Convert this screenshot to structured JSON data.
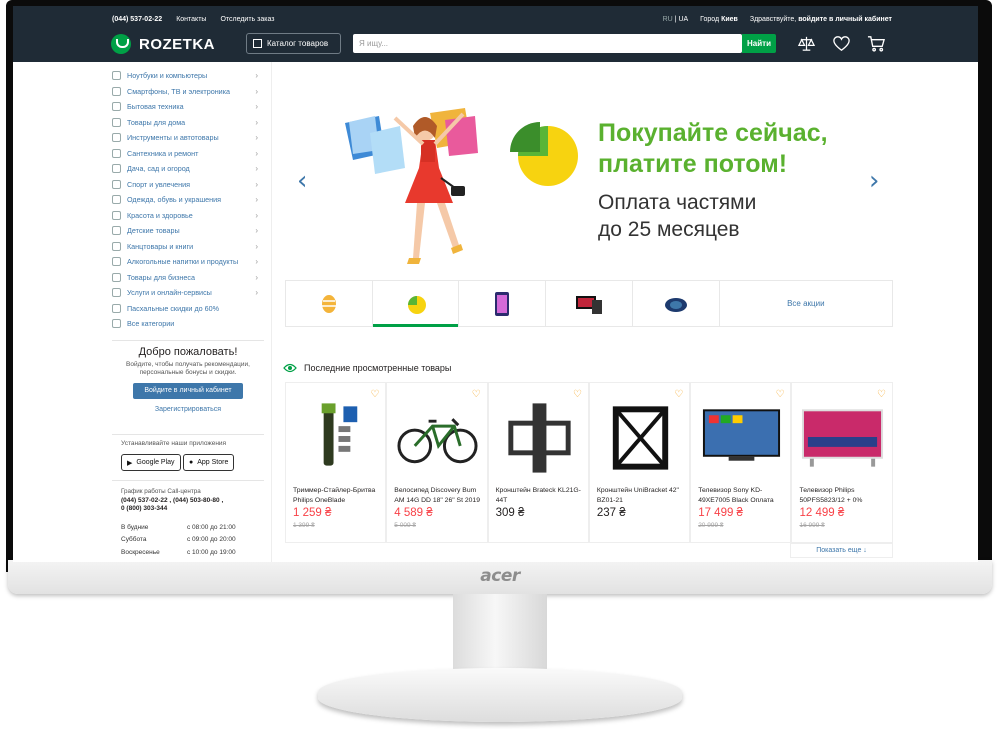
{
  "header": {
    "phone": "(044) 537-02-22",
    "contacts": "Контакты",
    "track": "Отследить заказ",
    "lang_ru": "RU",
    "lang_ua": "UA",
    "city_label": "Город",
    "city": "Киев",
    "greeting": "Здравствуйте,",
    "login_link": "войдите в личный кабинет",
    "logo": "ROZETKA",
    "catalog_button": "Каталог товаров",
    "search_placeholder": "Я ищу...",
    "search_button": "Найти",
    "icons": [
      "compare-icon",
      "heart-icon",
      "cart-icon"
    ]
  },
  "sidebar": {
    "categories": [
      "Ноутбуки и компьютеры",
      "Смартфоны, ТВ и электроника",
      "Бытовая техника",
      "Товары для дома",
      "Инструменты и автотовары",
      "Сантехника и ремонт",
      "Дача, сад и огород",
      "Спорт и увлечения",
      "Одежда, обувь и украшения",
      "Красота и здоровье",
      "Детские товары",
      "Канцтовары и книги",
      "Алкогольные напитки и продукты",
      "Товары для бизнеса",
      "Услуги и онлайн-сервисы",
      "Пасхальные скидки до 60%",
      "Все категории"
    ],
    "welcome_title": "Добро пожаловать!",
    "welcome_text": "Войдите, чтобы получать рекомендации, персональные бонусы и скидки.",
    "login_button": "Войдите в личный кабинет",
    "register": "Зарегистрироваться",
    "apps_title": "Устанавливайте наши приложения",
    "google_play": "Google Play",
    "app_store": "App Store",
    "callcenter_title": "График работы Call-центра",
    "callcenter_phones": "(044) 537-02-22 , (044) 503-80-80 ,",
    "callcenter_phone3": "0 (800) 303-344",
    "schedule": [
      {
        "day": "В будние",
        "time": "с 08:00 до 21:00"
      },
      {
        "day": "Суббота",
        "time": "с 09:00 до 20:00"
      },
      {
        "day": "Воскресенье",
        "time": "с 10:00 до 19:00"
      }
    ]
  },
  "banner": {
    "headline_1": "Покупайте сейчас,",
    "headline_2": "платите потом!",
    "sub_1": "Оплата частями",
    "sub_2": "до 25 месяцев",
    "all_promos": "Все акции"
  },
  "recent": {
    "title": "Последние просмотренные товары",
    "show_more": "Показать еще",
    "products": [
      {
        "name": "Триммер-Стайлер-Бритва Philips OneBlade",
        "price": "1 259 ₴",
        "old": "1 399 ₴",
        "sale": true
      },
      {
        "name": "Велосипед Discovery Bum AM 14G DD 18\" 26\" St 2019",
        "price": "4 589 ₴",
        "old": "5 009 ₴",
        "sale": true
      },
      {
        "name": "Кронштейн Brateck KL21G-44T",
        "price": "309 ₴",
        "old": "",
        "sale": false
      },
      {
        "name": "Кронштейн UniBracket 42\" BZ01-21",
        "price": "237 ₴",
        "old": "",
        "sale": false
      },
      {
        "name": "Телевизор Sony KD-49XE7005 Black Оплата",
        "price": "17 499 ₴",
        "old": "20 999 ₴",
        "sale": true
      },
      {
        "name": "Телевизор Philips 50PFS5823/12 + 0%",
        "price": "12 499 ₴",
        "old": "16 999 ₴",
        "sale": true
      }
    ]
  },
  "monitor_brand": "acer",
  "colors": {
    "header": "#1f2b36",
    "accent": "#00a046",
    "link": "#3e77aa",
    "sale": "#f84147",
    "headline": "#5ab12f"
  }
}
